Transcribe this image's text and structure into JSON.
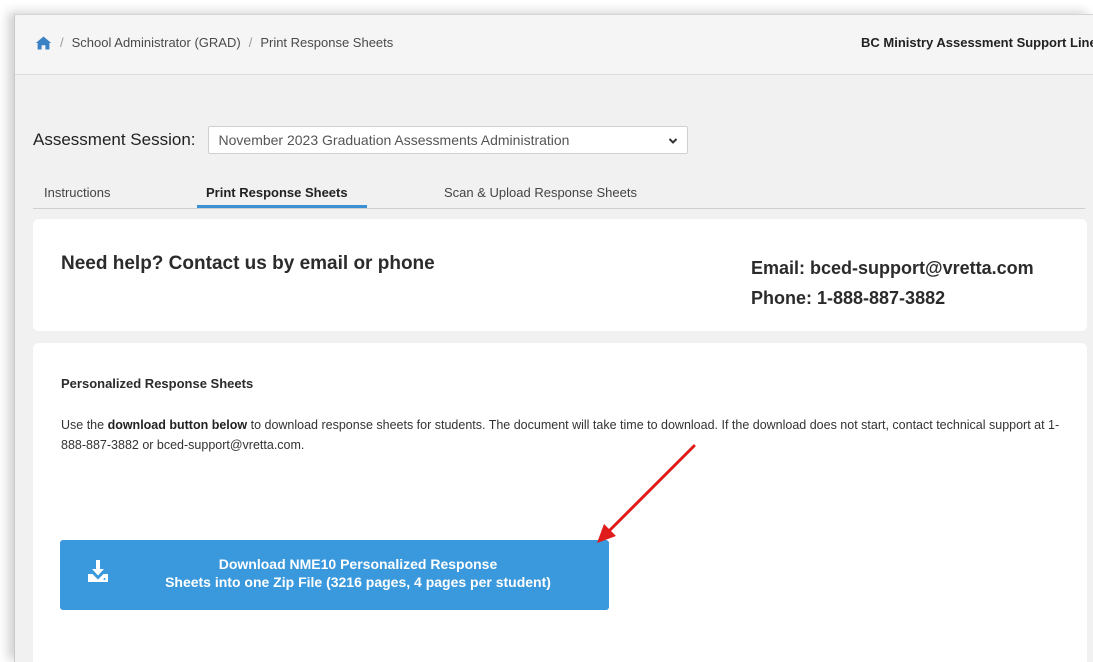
{
  "breadcrumb": {
    "items": [
      "School Administrator (GRAD)",
      "Print Response Sheets"
    ],
    "separator": "/"
  },
  "header": {
    "support_line": "BC Ministry Assessment Support Line"
  },
  "session": {
    "label": "Assessment Session:",
    "selected": "November 2023 Graduation Assessments Administration"
  },
  "tabs": [
    {
      "label": "Instructions"
    },
    {
      "label": "Print Response Sheets",
      "active": true
    },
    {
      "label": "Scan & Upload Response Sheets"
    }
  ],
  "help": {
    "title": "Need help? Contact us by email or phone",
    "email": "Email: bced-support@vretta.com",
    "phone": "Phone: 1-888-887-3882"
  },
  "sheets": {
    "title": "Personalized Response Sheets",
    "desc_prefix": "Use the ",
    "desc_bold": "download button below",
    "desc_suffix": " to download response sheets for students. The document will take time to download. If the download does not start, contact technical support at 1-888-887-3882 or bced-support@vretta.com.",
    "download_line1": "Download NME10 Personalized Response",
    "download_line2": "Sheets into one Zip File (3216 pages, 4 pages per student)"
  },
  "colors": {
    "accent": "#3a98dc",
    "tab_underline": "#3b8fd3",
    "home_icon": "#3b82c4",
    "arrow": "#e01b1b"
  },
  "icons": {
    "home": "home-icon",
    "dropdown": "chevron-down-icon",
    "download": "download-icon"
  }
}
